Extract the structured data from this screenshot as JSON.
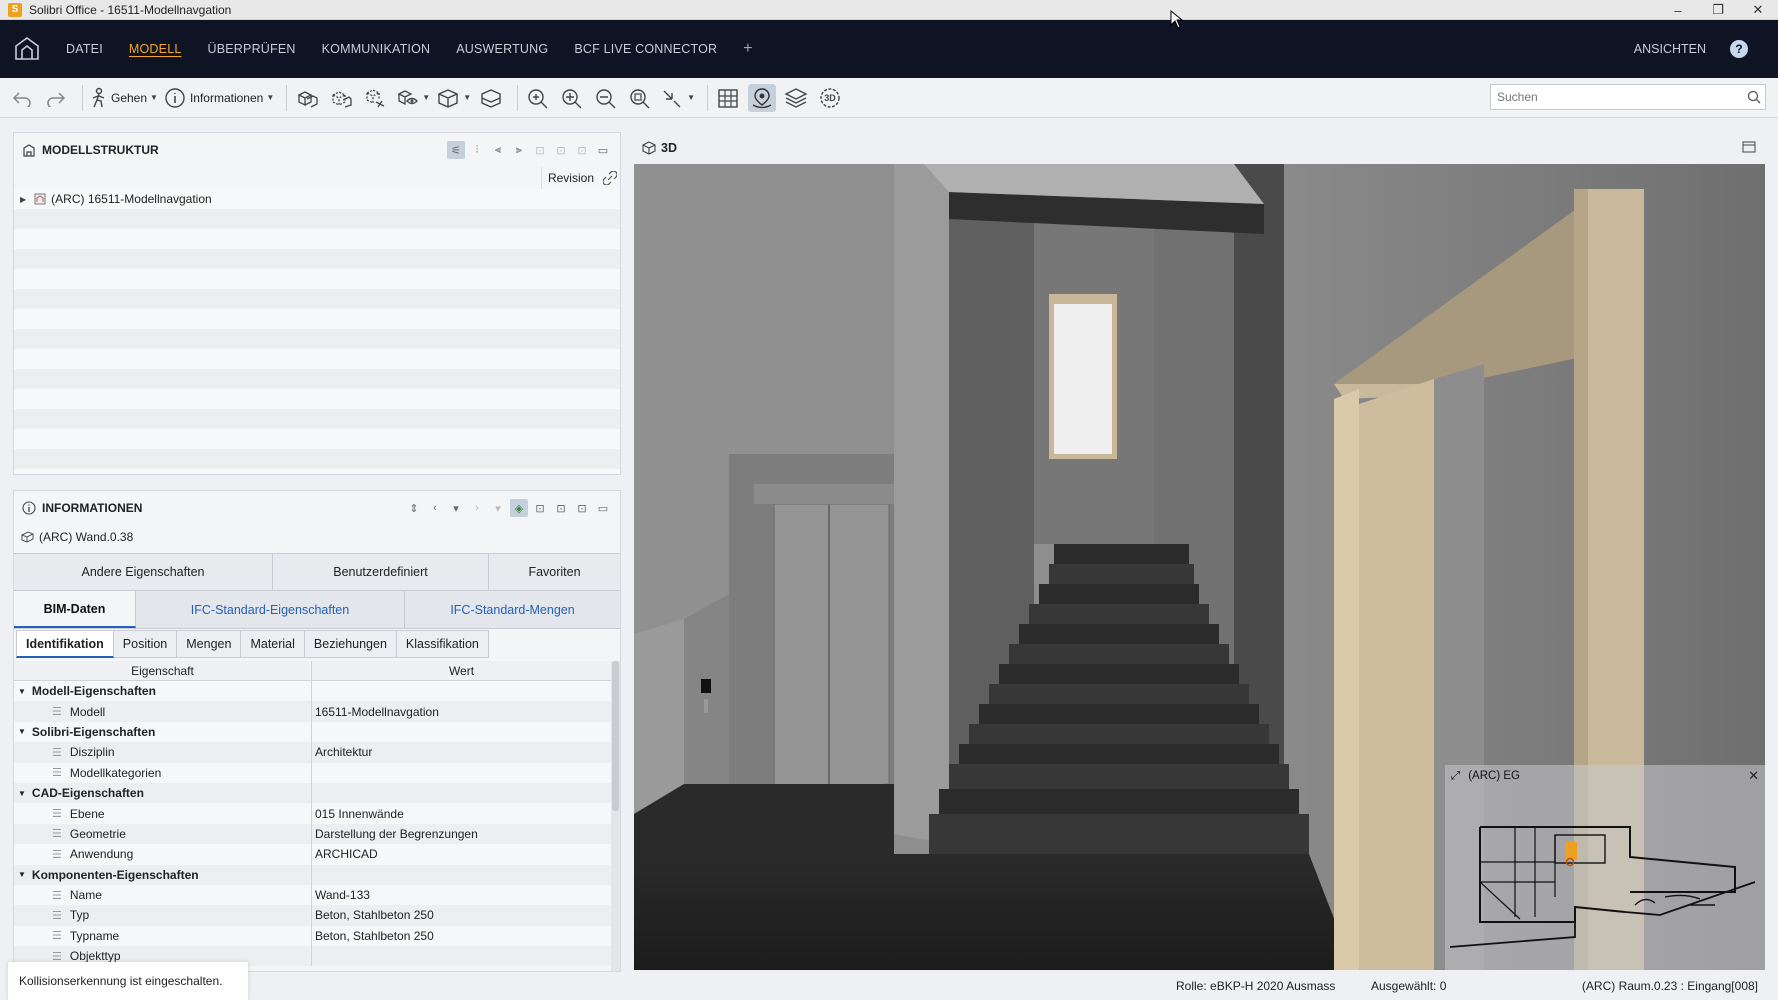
{
  "window": {
    "title": "Solibri Office - 16511-Modellnavgation",
    "logo_letter": "S",
    "minimize": "–",
    "restore": "❐",
    "close": "✕"
  },
  "menu": {
    "items": [
      "DATEI",
      "MODELL",
      "ÜBERPRÜFEN",
      "KOMMUNIKATION",
      "AUSWERTUNG",
      "BCF LIVE CONNECTOR"
    ],
    "active": "MODELL",
    "plus": "+",
    "ansichten": "ANSICHTEN",
    "help": "?"
  },
  "toolbar": {
    "gehen_label": "Gehen",
    "informationen_label": "Informationen",
    "search_placeholder": "Suchen",
    "label_3d": "3D"
  },
  "modellstruktur": {
    "title": "MODELLSTRUKTUR",
    "revision_label": "Revision",
    "tree": [
      {
        "label": "(ARC) 16511-Modellnavgation",
        "expanded": false
      }
    ]
  },
  "informationen": {
    "title": "INFORMATIONEN",
    "selected": "(ARC) Wand.0.38",
    "tabs_row1": [
      "Andere Eigenschaften",
      "Benutzerdefiniert",
      "Favoriten"
    ],
    "tabs_row2": [
      "BIM-Daten",
      "IFC-Standard-Eigenschaften",
      "IFC-Standard-Mengen"
    ],
    "tabs_row2_active": 0,
    "tabs_row3": [
      "Identifikation",
      "Position",
      "Mengen",
      "Material",
      "Beziehungen",
      "Klassifikation"
    ],
    "tabs_row3_active": 0,
    "col_property": "Eigenschaft",
    "col_value": "Wert",
    "rows": [
      {
        "type": "group",
        "key": "Modell-Eigenschaften",
        "value": ""
      },
      {
        "type": "item",
        "key": "Modell",
        "value": "16511-Modellnavgation"
      },
      {
        "type": "group",
        "key": "Solibri-Eigenschaften",
        "value": ""
      },
      {
        "type": "item",
        "key": "Disziplin",
        "value": "Architektur"
      },
      {
        "type": "item",
        "key": "Modellkategorien",
        "value": ""
      },
      {
        "type": "group",
        "key": "CAD-Eigenschaften",
        "value": ""
      },
      {
        "type": "item",
        "key": "Ebene",
        "value": "015 Innenwände"
      },
      {
        "type": "item",
        "key": "Geometrie",
        "value": "Darstellung der Begrenzungen"
      },
      {
        "type": "item",
        "key": "Anwendung",
        "value": "ARCHICAD"
      },
      {
        "type": "group",
        "key": "Komponenten-Eigenschaften",
        "value": ""
      },
      {
        "type": "item",
        "key": "Name",
        "value": "Wand-133"
      },
      {
        "type": "item",
        "key": "Typ",
        "value": "Beton, Stahlbeton 250"
      },
      {
        "type": "item",
        "key": "Typname",
        "value": "Beton, Stahlbeton 250"
      },
      {
        "type": "item",
        "key": "Objekttyp",
        "value": ""
      }
    ]
  },
  "view3d": {
    "title": "3D",
    "minimap_title": "(ARC) EG",
    "minimap_close": "✕"
  },
  "status": {
    "toast": "Kollisionserkennung ist eingeschalten.",
    "role": "Rolle: eBKP-H 2020 Ausmass",
    "selected": "Ausgewählt: 0",
    "room": "(ARC) Raum.0.23 : Eingang[008]"
  },
  "colors": {
    "menubar_bg": "#0f1424",
    "accent_orange": "#f5a623",
    "tab_blue": "#2660b8",
    "door_frame": "#c8b99a"
  }
}
